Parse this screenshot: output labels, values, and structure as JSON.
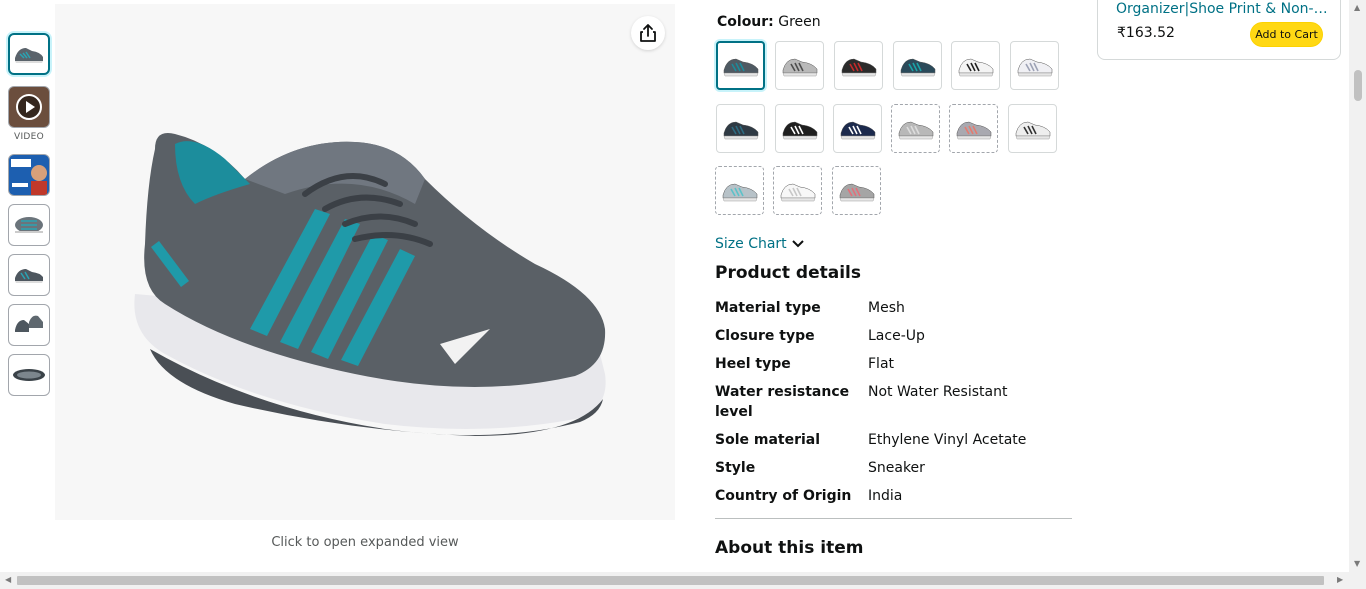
{
  "thumbnails": {
    "video_label": "VIDEO",
    "items": [
      "shoe-side",
      "video-play",
      "brand-ad",
      "shoe-top",
      "shoe-side-2",
      "shoe-pair",
      "shoe-sole"
    ]
  },
  "main": {
    "expand_text": "Click to open expanded view",
    "share_icon": "share-icon"
  },
  "colour": {
    "label": "Colour:",
    "value": "Green",
    "swatches": [
      {
        "name": "grey-teal",
        "colour": "#4f5a63",
        "accent": "#1e8a9a"
      },
      {
        "name": "grey-white",
        "colour": "#b9b9b9",
        "accent": "#4e4e4e"
      },
      {
        "name": "black-red",
        "colour": "#2b2b2b",
        "accent": "#c42b2b"
      },
      {
        "name": "teal-navy",
        "colour": "#2b4a5a",
        "accent": "#1aa3a8"
      },
      {
        "name": "white-black",
        "colour": "#f4f4f4",
        "accent": "#222222"
      },
      {
        "name": "white-grey",
        "colour": "#f0f0f4",
        "accent": "#9da2b5"
      },
      {
        "name": "dark-blue",
        "colour": "#2f3a44",
        "accent": "#2d6a80"
      },
      {
        "name": "black-white",
        "colour": "#1f1f1f",
        "accent": "#ffffff"
      },
      {
        "name": "navy",
        "colour": "#1c2a4d",
        "accent": "#ffffff"
      },
      {
        "name": "light-grey",
        "colour": "#b8b8b8",
        "accent": "#dcdcdc"
      },
      {
        "name": "grey-pink",
        "colour": "#a9a9b0",
        "accent": "#e57b6f"
      },
      {
        "name": "white-black-2",
        "colour": "#eeeeee",
        "accent": "#333333"
      },
      {
        "name": "grey-aqua",
        "colour": "#b7c2c8",
        "accent": "#5cc2c9"
      },
      {
        "name": "white-silver",
        "colour": "#f7f7f7",
        "accent": "#c7c7c7"
      },
      {
        "name": "grey-coral",
        "colour": "#a5a5a5",
        "accent": "#e2707a"
      }
    ]
  },
  "size_chart": {
    "label": "Size Chart"
  },
  "product_details": {
    "title": "Product details",
    "rows": [
      {
        "key": "Material type",
        "value": "Mesh"
      },
      {
        "key": "Closure type",
        "value": "Lace-Up"
      },
      {
        "key": "Heel type",
        "value": "Flat"
      },
      {
        "key": "Water resistance level",
        "value": "Not Water Resistant"
      },
      {
        "key": "Sole material",
        "value": "Ethylene Vinyl Acetate"
      },
      {
        "key": "Style",
        "value": "Sneaker"
      },
      {
        "key": "Country of Origin",
        "value": "India"
      }
    ]
  },
  "about": {
    "title": "About this item"
  },
  "side_card": {
    "title": "Organizer|Shoe Print & Non-Slip",
    "price": "₹163.52",
    "add_to_cart": "Add to Cart"
  }
}
